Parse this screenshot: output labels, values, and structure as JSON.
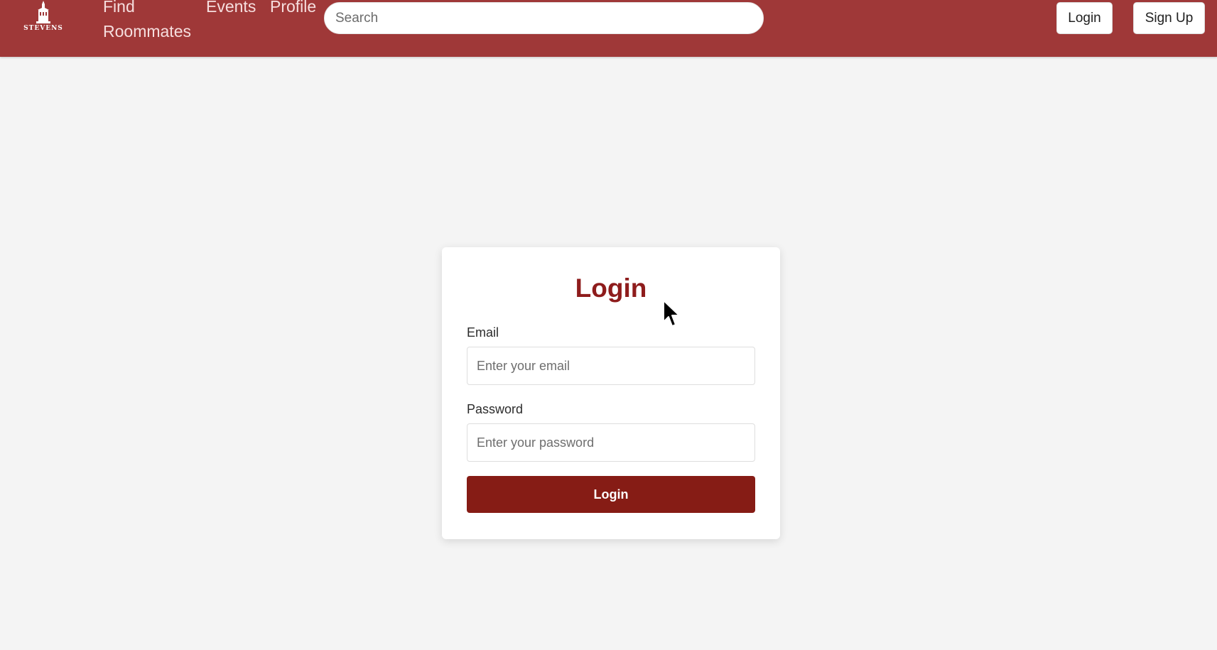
{
  "colors": {
    "navbar_bg": "#9f3838",
    "accent": "#8e1c1c",
    "button_bg": "#861c15",
    "page_bg": "#f4f4f4"
  },
  "brand": {
    "logo_text": "STEVENS",
    "logo_icon": "building-icon"
  },
  "nav": {
    "links": [
      {
        "label": "Find Roommates"
      },
      {
        "label": "Events"
      },
      {
        "label": "Profile"
      }
    ],
    "search_placeholder": "Search",
    "login_label": "Login",
    "signup_label": "Sign Up"
  },
  "login_form": {
    "title": "Login",
    "email_label": "Email",
    "email_placeholder": "Enter your email",
    "password_label": "Password",
    "password_placeholder": "Enter your password",
    "submit_label": "Login"
  },
  "cursor": {
    "icon": "mouse-pointer-icon"
  }
}
